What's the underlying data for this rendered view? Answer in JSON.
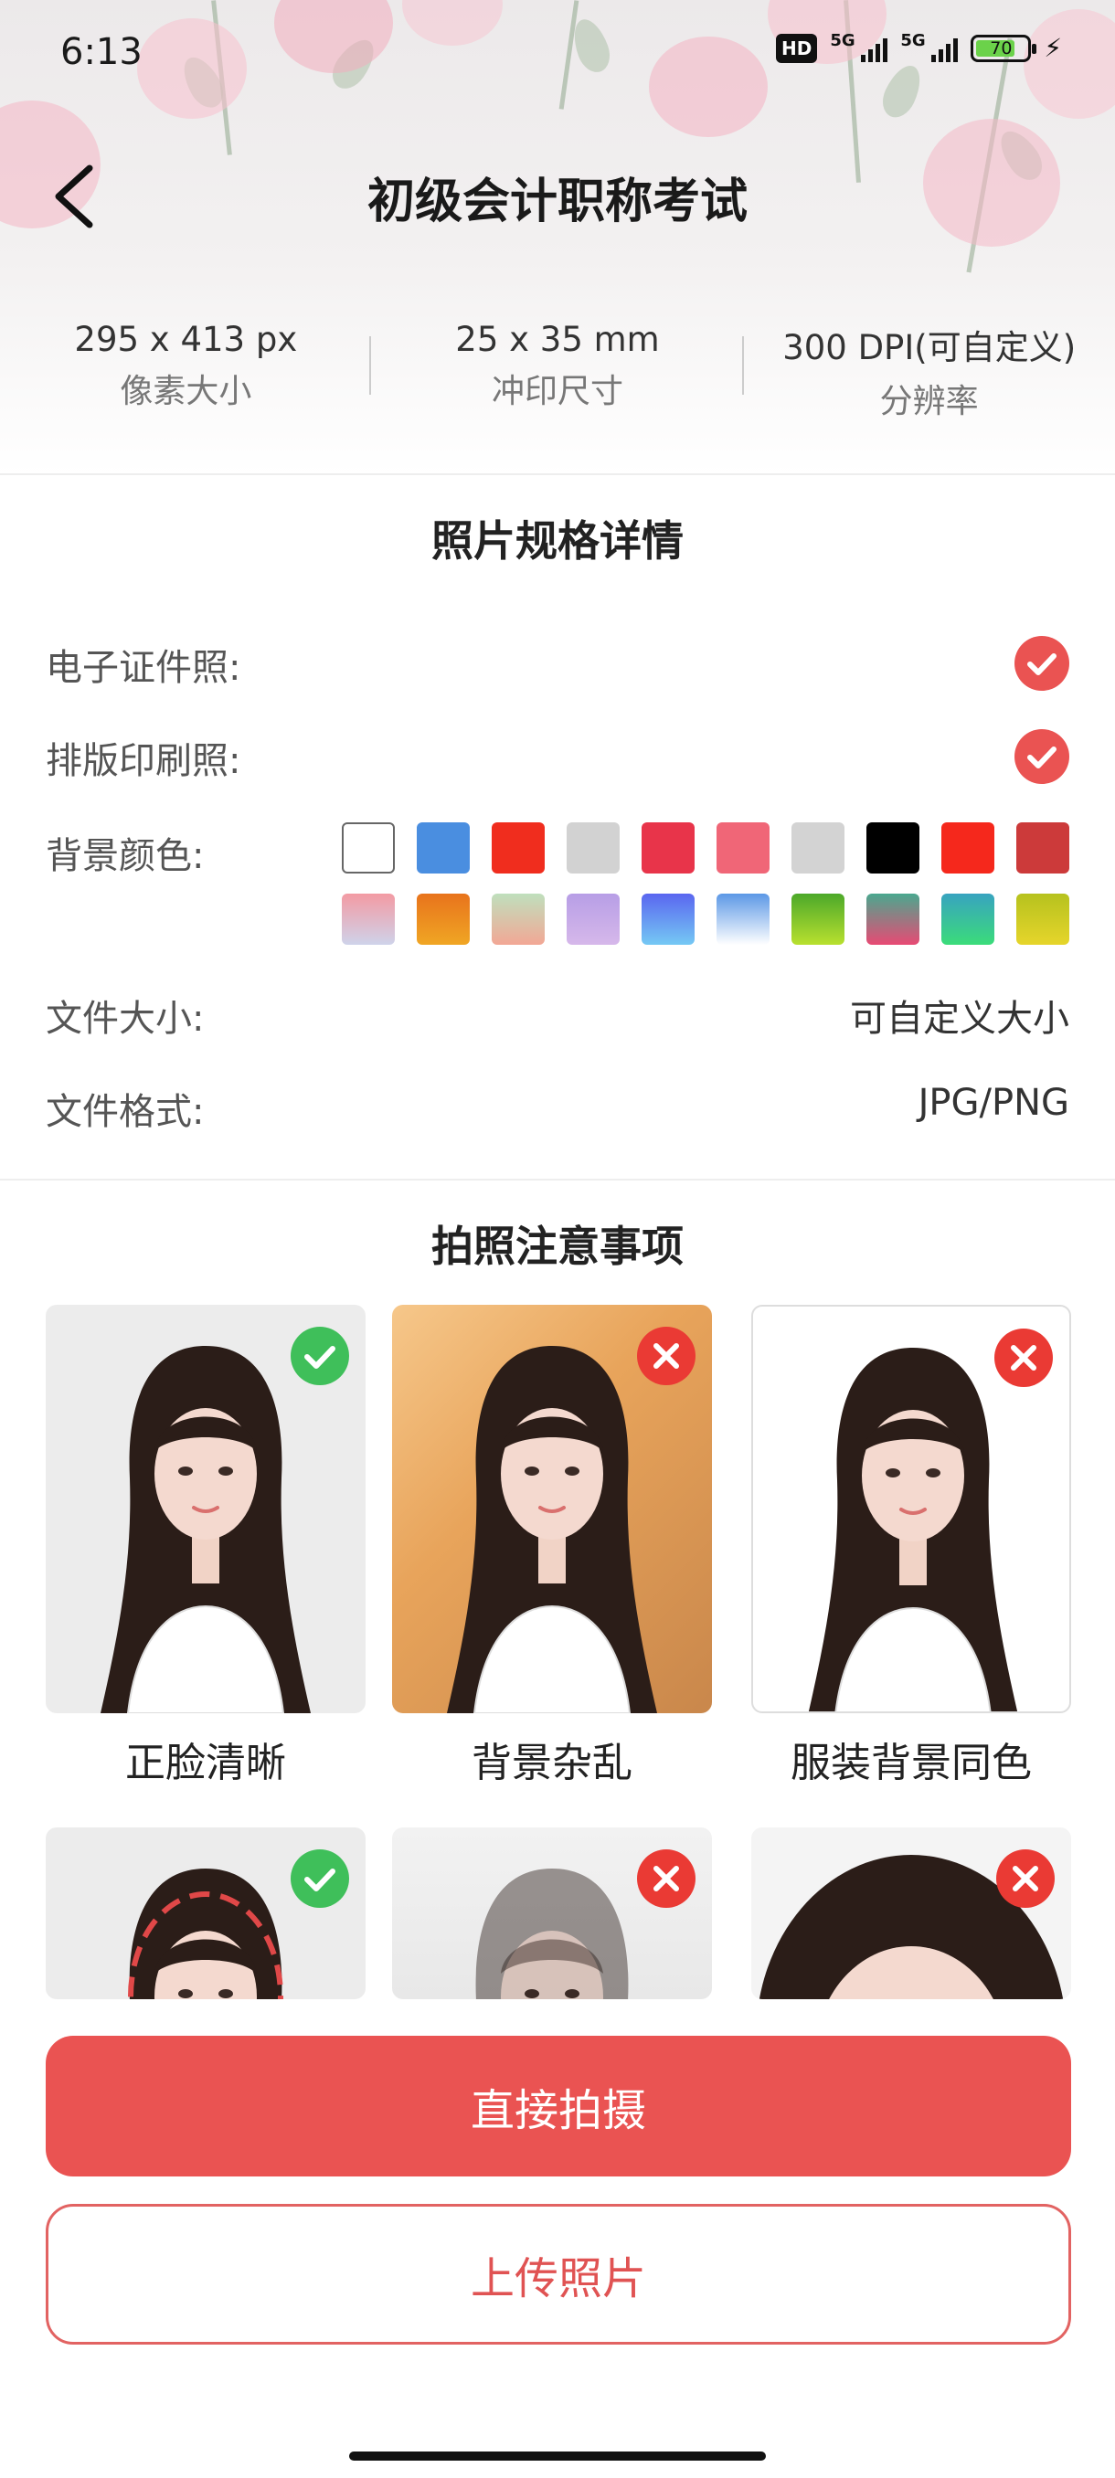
{
  "status_bar": {
    "time": "6:13",
    "hd_label": "HD",
    "network1": "5G",
    "network2": "5G",
    "battery": "70"
  },
  "header": {
    "title": "初级会计职称考试"
  },
  "specs": [
    {
      "value": "295 x 413 px",
      "label": "像素大小"
    },
    {
      "value": "25 x 35 mm",
      "label": "冲印尺寸"
    },
    {
      "value": "300 DPI(可自定义)",
      "label": "分辨率"
    }
  ],
  "details": {
    "title": "照片规格详情",
    "e_photo_label": "电子证件照:",
    "print_photo_label": "排版印刷照:",
    "bg_color_label": "背景颜色:",
    "file_size_label": "文件大小:",
    "file_size_value": "可自定义大小",
    "file_format_label": "文件格式:",
    "file_format_value": "JPG/PNG"
  },
  "bg_colors": [
    "#ffffff",
    "#4a8ee0",
    "#f02d1e",
    "#d2d2d2",
    "#e8344a",
    "#f06677",
    "#d3d3d3",
    "#000000",
    "#f5281c",
    "#cc3a3a",
    "linear-gradient(180deg,#f39aa3,#cfd3ea)",
    "linear-gradient(180deg,#e8731c,#f0a624)",
    "linear-gradient(180deg,#bfe0bd,#f2a795)",
    "linear-gradient(180deg,#b79ee6,#d6b8ea)",
    "linear-gradient(180deg,#5a66f0,#75c9f4)",
    "linear-gradient(180deg,#5c98e6,#ffffff)",
    "linear-gradient(180deg,#4ca82a,#b9e02f)",
    "linear-gradient(180deg,#4aa88f,#e84a74)",
    "linear-gradient(180deg,#38a3c0,#3bdc7a)",
    "linear-gradient(180deg,#b6c21e,#e6d52b)"
  ],
  "tips": {
    "title": "拍照注意事项",
    "cards": [
      {
        "label": "正脸清晰",
        "status": "ok"
      },
      {
        "label": "背景杂乱",
        "status": "bad"
      },
      {
        "label": "服装背景同色",
        "status": "bad"
      },
      {
        "label": "",
        "status": "ok"
      },
      {
        "label": "",
        "status": "bad"
      },
      {
        "label": "",
        "status": "bad"
      }
    ]
  },
  "actions": {
    "shoot": "直接拍摄",
    "upload": "上传照片"
  }
}
